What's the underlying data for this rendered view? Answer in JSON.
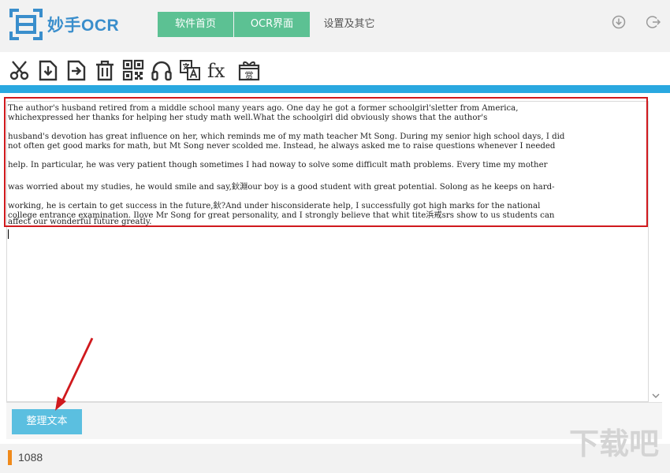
{
  "header": {
    "logo_text": "妙手OCR",
    "tabs": [
      {
        "label": "软件首页"
      },
      {
        "label": "OCR界面"
      },
      {
        "label": "设置及其它"
      }
    ],
    "icons": [
      "download-icon",
      "logout-icon"
    ]
  },
  "toolbar": {
    "buttons": [
      "scissors-icon",
      "import-icon",
      "export-icon",
      "delete-icon",
      "qrcode-icon",
      "headphones-icon",
      "translate-icon",
      "formula-icon",
      "reward-icon"
    ],
    "formula_label": "fx",
    "reward_label": "赏"
  },
  "colors": {
    "tab_green": "#5cc193",
    "accent_blue": "#29a8e0",
    "highlight_red": "#d0191d",
    "status_orange": "#f08a1b",
    "button_blue": "#5bbfe0"
  },
  "ocr_text": {
    "lines": [
      "The author's husband retired from a middle school many years ago. One day he got a former schoolgirl'sletter from America,",
      "whichexpressed her thanks for helping her study math well.What the schoolgirl did obviously shows that the author's",
      "",
      "husband's devotion has great influence on her, which reminds me of my math teacher Mt Song. During my senior high school days, I did",
      "not often get good marks for math, but Mt Song never scolded me. Instead, he always asked me to raise questions whenever I needed",
      "",
      "help. In particular, he was very patient though sometimes I had noway to solve some difficult math problems. Every time my mother",
      "",
      "was worried about my studies, he would smile and say,鈥淵our boy is a good student with great potential. Solong as he keeps on hard-",
      "",
      "working, he is certain to get success in the future,鈥?And under hisconsiderate help, I successfully got high marks for the national",
      "college entrance examination. Ilove Mr Song for great personality, and I strongly believe that whit tite浜戒srs show to us students can",
      "affect our wonderful future greatly."
    ]
  },
  "actions": {
    "tidy_text_label": "整理文本"
  },
  "status": {
    "count": "1088"
  },
  "watermark": {
    "text": "下载吧"
  }
}
